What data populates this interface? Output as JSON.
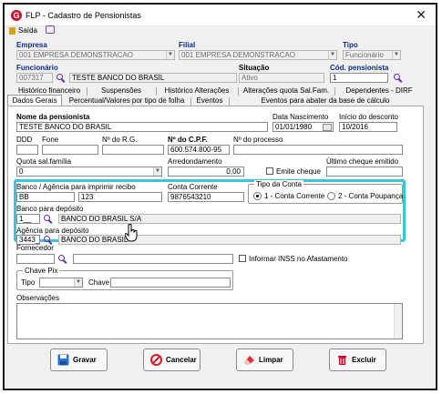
{
  "window": {
    "title": "FLP - Cadastro de Pensionistas"
  },
  "toolbar": {
    "exit_label": "Saída"
  },
  "header": {
    "empresa_label": "Empresa",
    "empresa_value": "001 EMPRESA DEMONSTRACAO",
    "filial_label": "Filial",
    "filial_value": "001 EMPRESA DEMONSTRACAO",
    "tipo_label": "Tipo",
    "tipo_value": "Funcionário",
    "funcionario_label": "Funcionário",
    "funcionario_code": "007317",
    "funcionario_name": "TESTE BANCO DO BRASIL",
    "situacao_label": "Situação",
    "situacao_value": "Ativo",
    "cod_pensionista_label": "Cód. pensionista",
    "cod_pensionista_value": "1"
  },
  "tabs": {
    "row1": [
      "Histórico financeiro",
      "Suspensões",
      "Histórico Alterações",
      "Alterações quota Sal.Fam.",
      "Dependentes - DIRF"
    ],
    "row2": [
      "Dados Gerais",
      "Percentual/Valores por tipo de folha",
      "Eventos",
      "Eventos para abater da base de cálculo"
    ]
  },
  "form": {
    "nome_label": "Nome da pensionista",
    "nome_value": "TESTE BANCO DO BRASIL",
    "data_nasc_label": "Data Nascimento",
    "data_nasc_value": "01/01/1980",
    "inicio_desc_label": "Início do desconto",
    "inicio_desc_value": "10/2016",
    "ddd_label": "DDD",
    "fone_label": "Fone",
    "rg_label": "Nº do R.G.",
    "cpf_label": "Nº do C.P.F.",
    "cpf_value": "600.574.800-95",
    "processo_label": "Nº do processo",
    "quota_label": "Quota sal.família",
    "quota_value": "0",
    "arred_label": "Arredondamento",
    "arred_value": "0,00",
    "emite_cheque_label": "Emite cheque",
    "ultimo_cheque_label": "Último cheque emitido",
    "banco_agencia_label": "Banco / Agência para imprimir recibo",
    "banco_value": "BB",
    "agencia_value": "123",
    "conta_label": "Conta Corrente",
    "conta_value": "9876543210",
    "tipo_conta_label": "Tipo da Conta",
    "tipo_conta_options": [
      "1 - Conta Corrente",
      "2 - Conta Poupança"
    ],
    "banco_dep_label": "Banco para depósito",
    "banco_dep_code": "1__",
    "banco_dep_name": "BANCO DO BRASIL S/A",
    "agencia_dep_label": "Agência para depósito",
    "agencia_dep_code": "3443_",
    "agencia_dep_name": "BANCO DO BRASIL",
    "fornecedor_label": "Fornecedor",
    "inss_label": "Informar INSS no Afastamento",
    "chave_pix_label": "Chave Pix",
    "pix_tipo_label": "Tipo",
    "pix_chave_label": "Chave",
    "obs_label": "Observações"
  },
  "buttons": {
    "save": "Gravar",
    "cancel": "Cancelar",
    "clear": "Limpar",
    "delete": "Excluir"
  },
  "colors": {
    "highlight": "#3cc6d3",
    "label_blue": "#0b2d8a",
    "brand_red": "#c8102e",
    "lookup_purple": "#6b2aa8"
  }
}
